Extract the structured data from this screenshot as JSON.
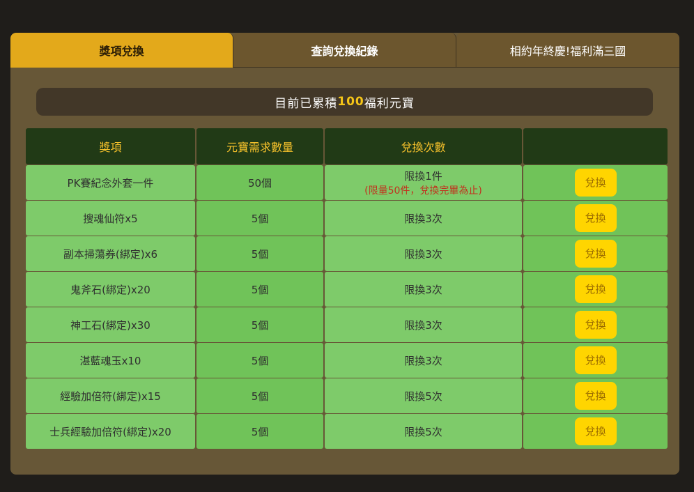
{
  "tabs": [
    {
      "label": "獎項兌換"
    },
    {
      "label": "查詢兌換紀錄"
    },
    {
      "label": "相約年終慶!福利滿三國"
    }
  ],
  "summary": {
    "prefix": "目前已累積",
    "amount": "100",
    "suffix": "福利元寶"
  },
  "table": {
    "headers": [
      "獎項",
      "元寶需求數量",
      "兌換次數",
      ""
    ],
    "button_label": "兌換",
    "rows": [
      {
        "item": "PK賽紀念外套一件",
        "cost": "50個",
        "limit": "限換1件",
        "note": "(限量50件，兌換完畢為止)"
      },
      {
        "item": "搜魂仙符x5",
        "cost": "5個",
        "limit": "限換3次",
        "note": ""
      },
      {
        "item": "副本掃蕩券(綁定)x6",
        "cost": "5個",
        "limit": "限換3次",
        "note": ""
      },
      {
        "item": "鬼斧石(綁定)x20",
        "cost": "5個",
        "limit": "限換3次",
        "note": ""
      },
      {
        "item": "神工石(綁定)x30",
        "cost": "5個",
        "limit": "限換3次",
        "note": ""
      },
      {
        "item": "湛藍魂玉x10",
        "cost": "5個",
        "limit": "限換3次",
        "note": ""
      },
      {
        "item": "經驗加倍符(綁定)x15",
        "cost": "5個",
        "limit": "限換5次",
        "note": ""
      },
      {
        "item": "士兵經驗加倍符(綁定)x20",
        "cost": "5個",
        "limit": "限換5次",
        "note": ""
      }
    ]
  }
}
